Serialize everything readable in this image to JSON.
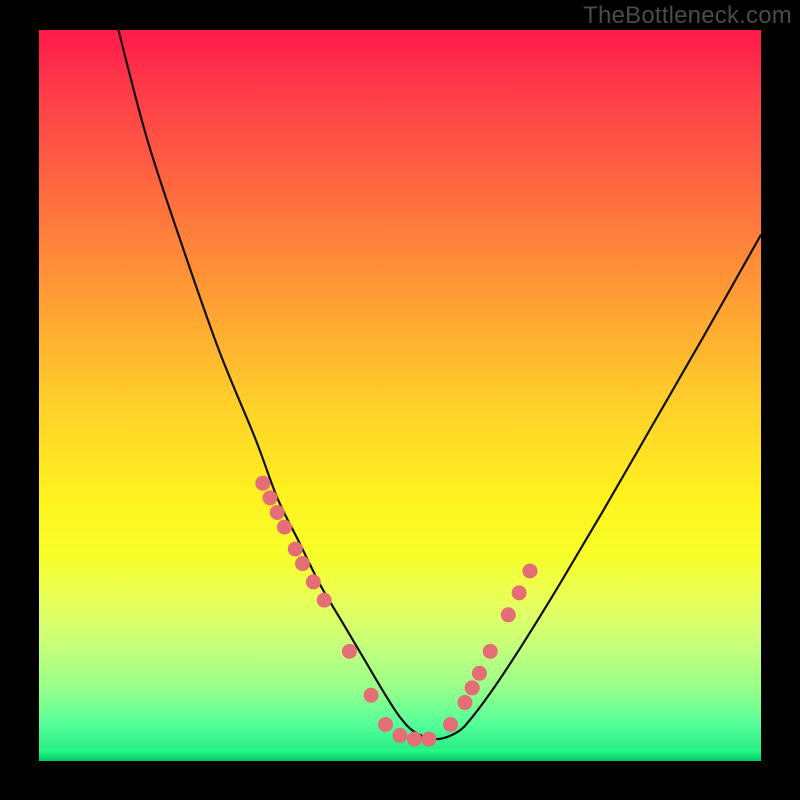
{
  "watermark": "TheBottleneck.com",
  "colors": {
    "background": "#000000",
    "curve": "#111111",
    "dot": "#e46d76",
    "gradient_stops": [
      "#ff1a4a",
      "#ff3a49",
      "#ff6a3f",
      "#ffa233",
      "#ffd22a",
      "#fff21f",
      "#f7ff2a",
      "#e8ff5a",
      "#c8ff7a",
      "#98ff8a",
      "#55ff9a",
      "#15e57a"
    ]
  },
  "chart_data": {
    "type": "line",
    "title": "",
    "xlabel": "",
    "ylabel": "",
    "xlim": [
      0,
      100
    ],
    "ylim": [
      0,
      100
    ],
    "series": [
      {
        "name": "bottleneck-curve",
        "x": [
          11,
          15,
          20,
          25,
          30,
          33,
          36,
          39,
          42,
          45,
          48,
          50,
          52,
          55,
          58,
          60,
          63,
          67,
          72,
          78,
          85,
          92,
          100
        ],
        "y": [
          100,
          85,
          70,
          56,
          44,
          36,
          30,
          24,
          19,
          14,
          9,
          6,
          4,
          3,
          4,
          6,
          10,
          16,
          24,
          34,
          46,
          58,
          72
        ]
      }
    ],
    "scatter_points": {
      "name": "highlight-dots",
      "x": [
        31,
        32,
        33,
        34,
        35.5,
        36.5,
        38,
        39.5,
        43,
        46,
        48,
        50,
        52,
        54,
        57,
        59,
        60,
        61,
        62.5,
        65,
        66.5,
        68
      ],
      "y": [
        38,
        36,
        34,
        32,
        29,
        27,
        24.5,
        22,
        15,
        9,
        5,
        3.5,
        3,
        3,
        5,
        8,
        10,
        12,
        15,
        20,
        23,
        26
      ]
    }
  }
}
